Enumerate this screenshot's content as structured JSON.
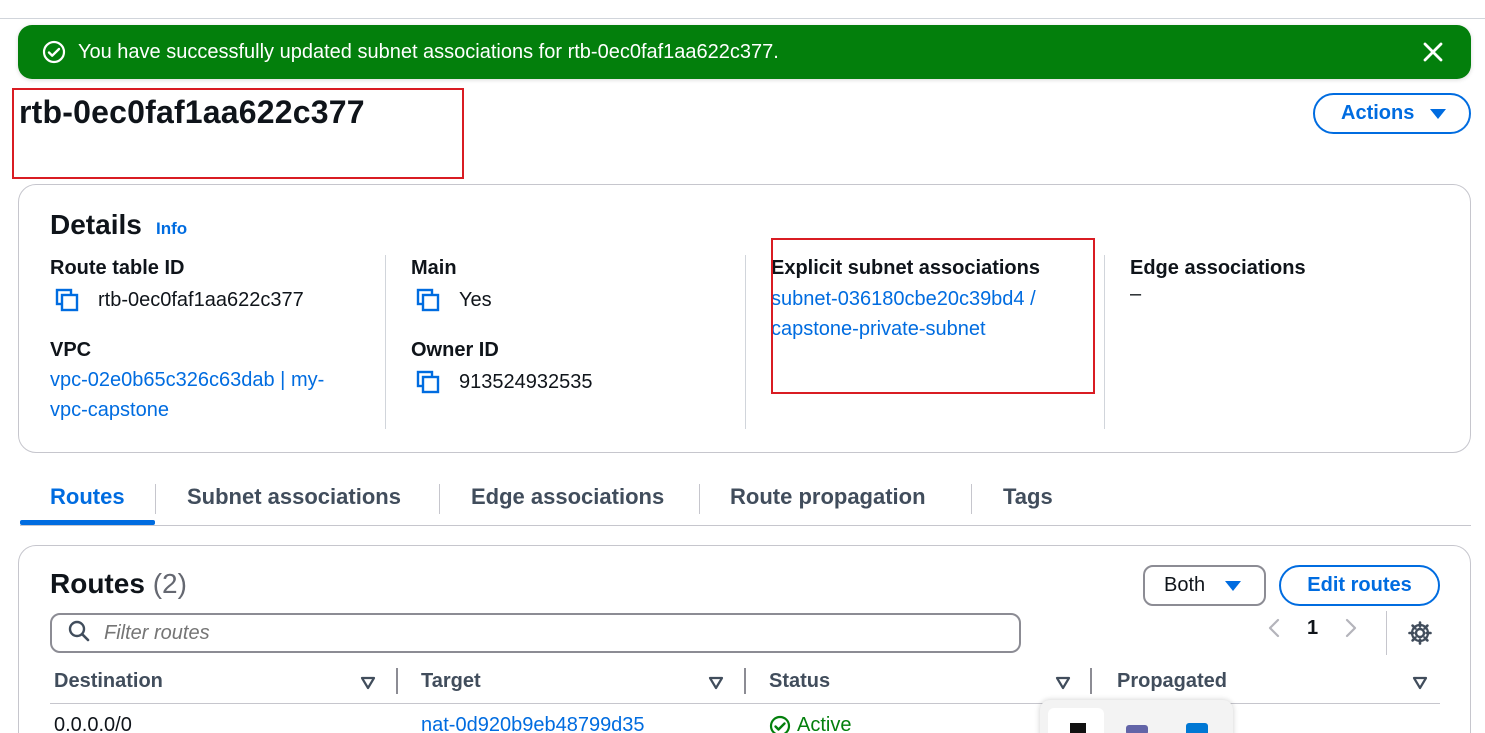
{
  "flash": {
    "message": "You have successfully updated subnet associations for rtb-0ec0faf1aa622c377.",
    "color": "#037f0c"
  },
  "header": {
    "title": "rtb-0ec0faf1aa622c377",
    "actions_label": "Actions"
  },
  "details": {
    "heading": "Details",
    "info_label": "Info",
    "route_table_id_label": "Route table ID",
    "route_table_id": "rtb-0ec0faf1aa622c377",
    "vpc_label": "VPC",
    "vpc_line1": "vpc-02e0b65c326c63dab | my-",
    "vpc_line2": "vpc-capstone",
    "main_label": "Main",
    "main_value": "Yes",
    "owner_label": "Owner ID",
    "owner_value": "913524932535",
    "explicit_label": "Explicit subnet associations",
    "explicit_line1": "subnet-036180cbe20c39bd4 /",
    "explicit_line2": "capstone-private-subnet",
    "edge_label": "Edge associations",
    "edge_value": "–"
  },
  "tabs": [
    "Routes",
    "Subnet associations",
    "Edge associations",
    "Route propagation",
    "Tags"
  ],
  "routes": {
    "title": "Routes",
    "count": "(2)",
    "filter_select": "Both",
    "edit_label": "Edit routes",
    "filter_placeholder": "Filter routes",
    "page": "1",
    "columns": [
      "Destination",
      "Target",
      "Status",
      "Propagated"
    ],
    "rows": [
      {
        "destination": "0.0.0.0/0",
        "target": "nat-0d920b9eb48799d35",
        "status": "Active",
        "propagated": ""
      }
    ]
  },
  "colors": {
    "link": "#006ce0",
    "success": "#037f0c",
    "highlight": "#d91c23"
  }
}
